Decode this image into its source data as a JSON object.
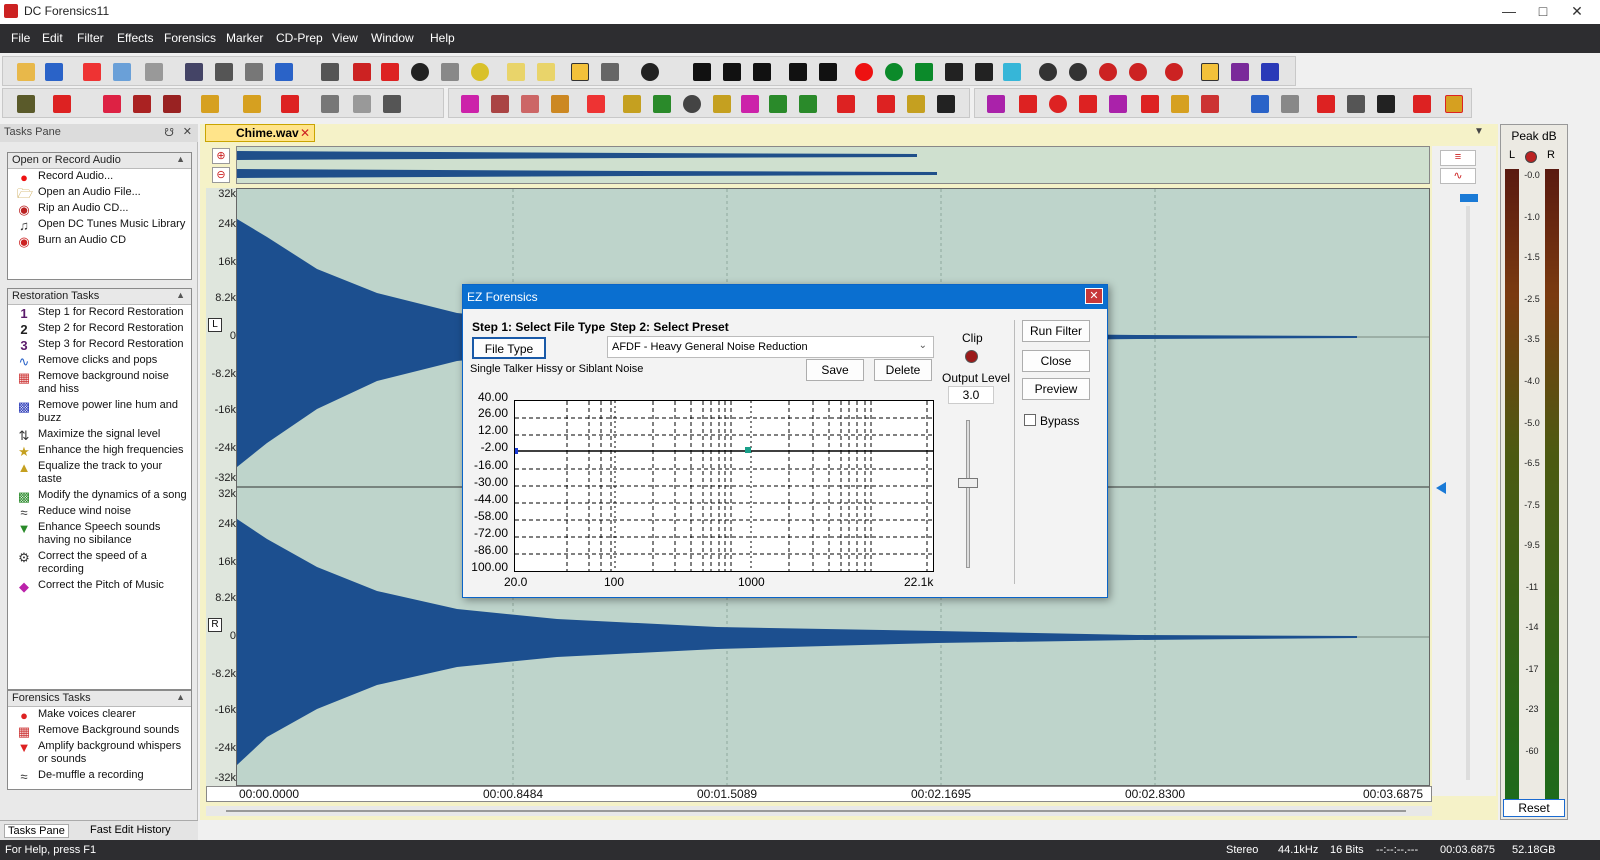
{
  "app": {
    "title": "DC Forensics11"
  },
  "menu": [
    "File",
    "Edit",
    "Filter",
    "Effects",
    "Forensics",
    "Marker",
    "CD-Prep",
    "View",
    "Window",
    "Help"
  ],
  "tasks_pane": {
    "header": "Tasks Pane",
    "sections": [
      {
        "title": "Open or Record Audio",
        "items": [
          {
            "icon": "record-icon",
            "label": "Record Audio..."
          },
          {
            "icon": "folder-icon",
            "label": "Open an Audio File..."
          },
          {
            "icon": "cd-rip-icon",
            "label": "Rip an Audio CD..."
          },
          {
            "icon": "music-library-icon",
            "label": "Open DC Tunes Music Library"
          },
          {
            "icon": "cd-burn-icon",
            "label": "Burn an Audio CD"
          }
        ]
      },
      {
        "title": "Restoration Tasks",
        "items": [
          {
            "icon": "step1-icon",
            "label": "Step 1 for Record Restoration"
          },
          {
            "icon": "step2-icon",
            "label": "Step 2 for Record Restoration"
          },
          {
            "icon": "step3-icon",
            "label": "Step 3 for Record Restoration"
          },
          {
            "icon": "declick-icon",
            "label": "Remove clicks and pops"
          },
          {
            "icon": "noise-icon",
            "label": "Remove background noise and hiss"
          },
          {
            "icon": "hum-icon",
            "label": "Remove power line hum and buzz"
          },
          {
            "icon": "maximize-icon",
            "label": "Maximize the signal level"
          },
          {
            "icon": "enhance-icon",
            "label": "Enhance the high frequencies"
          },
          {
            "icon": "equalize-icon",
            "label": "Equalize the track to your taste"
          },
          {
            "icon": "dynamics-icon",
            "label": "Modify the dynamics of a song"
          },
          {
            "icon": "wind-icon",
            "label": "Reduce wind noise"
          },
          {
            "icon": "speech-icon",
            "label": "Enhance Speech sounds having no sibilance"
          },
          {
            "icon": "speed-icon",
            "label": "Correct the speed of a recording"
          },
          {
            "icon": "pitch-icon",
            "label": "Correct the Pitch of Music"
          }
        ]
      },
      {
        "title": "Forensics Tasks",
        "items": [
          {
            "icon": "lips-icon",
            "label": "Make voices clearer"
          },
          {
            "icon": "remove-bg-icon",
            "label": "Remove Background sounds"
          },
          {
            "icon": "amplify-icon",
            "label": "Amplify background whispers or sounds"
          },
          {
            "icon": "demuffle-icon",
            "label": "De-muffle a recording"
          }
        ]
      }
    ],
    "bottom_tabs": [
      "Tasks Pane",
      "Fast Edit History"
    ]
  },
  "document": {
    "tab": "Chime.wav",
    "y_labels_top": [
      "32k",
      "24k",
      "16k",
      "8.2k",
      "0",
      "-8.2k",
      "-16k",
      "-24k",
      "-32k"
    ],
    "y_labels_bottom": [
      "32k",
      "24k",
      "16k",
      "8.2k",
      "0",
      "-8.2k",
      "-16k",
      "-24k",
      "-32k"
    ],
    "channel_top": "L",
    "channel_bottom": "R",
    "timeline": [
      "00:00.0000",
      "00:00.8484",
      "00:01.5089",
      "00:02.1695",
      "00:02.8300",
      "00:03.6875"
    ]
  },
  "peak_meter": {
    "title": "Peak dB",
    "left": "L",
    "right": "R",
    "scale": [
      "-0.0",
      "-1.0",
      "-1.5",
      "-2.5",
      "-3.5",
      "-4.0",
      "-5.0",
      "-6.5",
      "-7.5",
      "-9.5",
      "-11",
      "-14",
      "-17",
      "-23",
      "-60"
    ],
    "reset_label": "Reset"
  },
  "dialog": {
    "title": "EZ Forensics",
    "step1": "Step 1: Select File Type",
    "step2": "Step 2: Select Preset",
    "file_type_button": "File Type",
    "file_type_value": "Single Talker Hissy or Siblant Noise",
    "preset_value": "AFDF - Heavy General Noise Reduction",
    "save": "Save",
    "delete": "Delete",
    "clip": "Clip",
    "output_level_label": "Output Level",
    "output_level_value": "3.0",
    "run_filter": "Run Filter",
    "close": "Close",
    "preview": "Preview",
    "bypass": "Bypass",
    "graph_y": [
      "40.00",
      "26.00",
      "12.00",
      "-2.00",
      "-16.00",
      "-30.00",
      "-44.00",
      "-58.00",
      "-72.00",
      "-86.00",
      "100.00"
    ],
    "graph_x": [
      "20.0",
      "100",
      "1000",
      "22.1k"
    ]
  },
  "status": {
    "help": "For Help, press F1",
    "channels": "Stereo",
    "rate": "44.1kHz",
    "bits": "16 Bits",
    "cursor": "--:--:--.---",
    "length": "00:03.6875",
    "disk": "52.18GB"
  }
}
